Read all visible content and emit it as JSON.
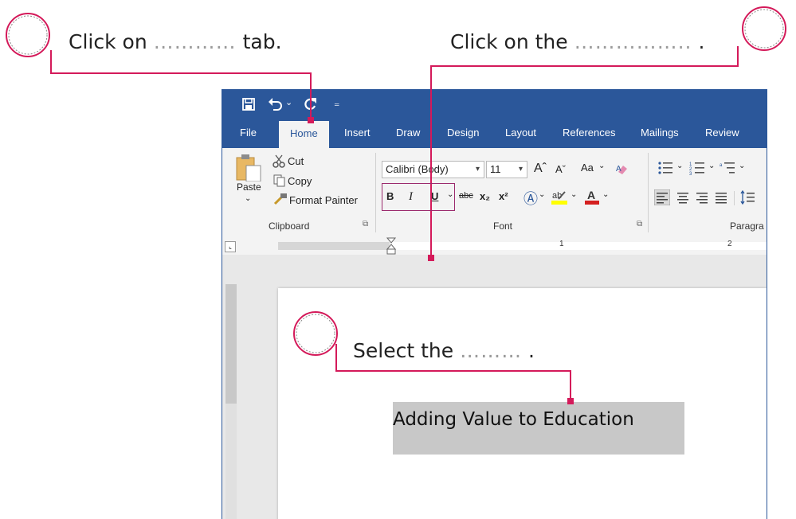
{
  "prompts": {
    "tab_prefix": "Click on",
    "tab_dots": "…………",
    "tab_suffix": "tab.",
    "button_prefix": "Click on the",
    "button_dots": "……………..",
    "button_suffix": ".",
    "select_prefix": "Select the",
    "select_dots": "………",
    "select_suffix": "."
  },
  "colors": {
    "accent": "#d41a5a",
    "word_blue": "#2b579a"
  },
  "tabs": [
    "File",
    "Home",
    "Insert",
    "Draw",
    "Design",
    "Layout",
    "References",
    "Mailings",
    "Review"
  ],
  "active_tab": "Home",
  "clipboard": {
    "paste": "Paste",
    "cut": "Cut",
    "copy": "Copy",
    "format_painter": "Format Painter",
    "group_label": "Clipboard"
  },
  "font": {
    "family": "Calibri (Body)",
    "size": "11",
    "change_case": "Aa",
    "group_label": "Font",
    "bold": "B",
    "italic": "I",
    "underline": "U",
    "strikethrough": "abc",
    "subscript": "x₂",
    "superscript": "x²"
  },
  "paragraph": {
    "group_label": "Paragra"
  },
  "ruler": {
    "one": "1",
    "two": "2"
  },
  "document": {
    "selected_text": "Adding Value to Education"
  },
  "icons": [
    "save-icon",
    "undo-icon",
    "redo-icon",
    "quick-access-more-icon",
    "cut-icon",
    "copy-icon",
    "format-painter-icon",
    "paste-icon"
  ]
}
